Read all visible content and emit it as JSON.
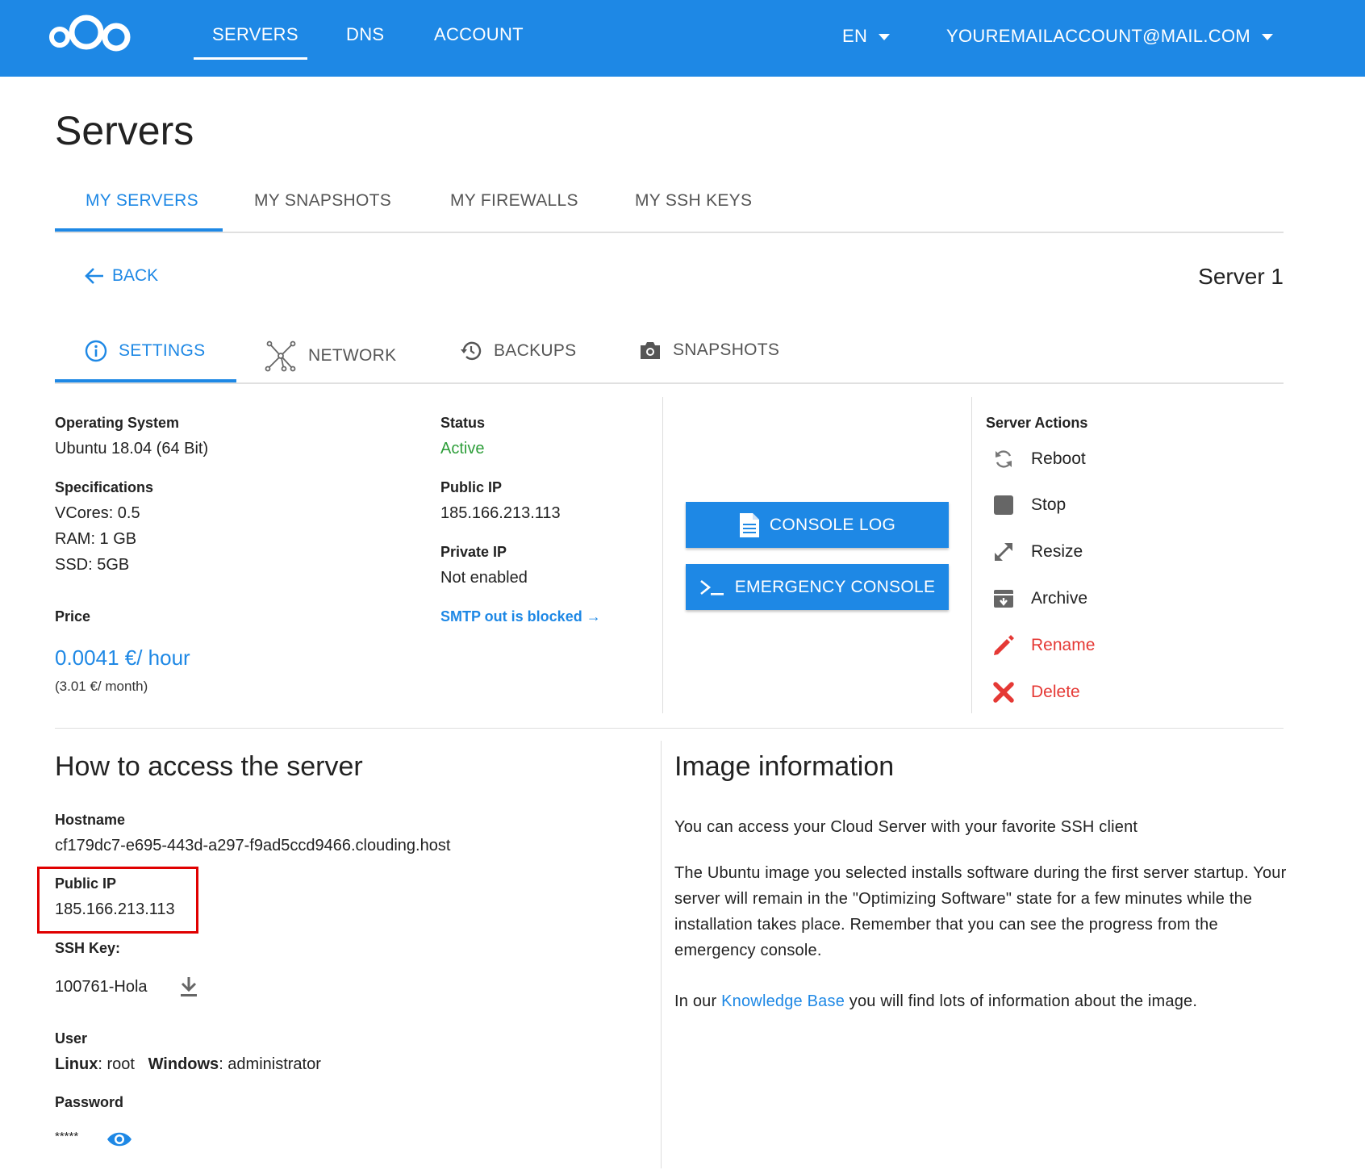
{
  "topbar": {
    "logo": "nextcloud-style-logo",
    "nav": [
      "SERVERS",
      "DNS",
      "ACCOUNT"
    ],
    "active_nav": "SERVERS",
    "language": "EN",
    "account": "YOUREMAILACCOUNT@MAIL.COM"
  },
  "page": {
    "title": "Servers"
  },
  "tabs": [
    "MY SERVERS",
    "MY SNAPSHOTS",
    "MY FIREWALLS",
    "MY SSH KEYS"
  ],
  "active_tab": "MY SERVERS",
  "back_label": "BACK",
  "server_name": "Server 1",
  "subtabs": [
    {
      "label": "SETTINGS",
      "icon": "info-icon"
    },
    {
      "label": "NETWORK",
      "icon": "network-icon"
    },
    {
      "label": "BACKUPS",
      "icon": "history-icon"
    },
    {
      "label": "SNAPSHOTS",
      "icon": "camera-icon"
    }
  ],
  "details": {
    "os_label": "Operating System",
    "os_value": "Ubuntu 18.04 (64 Bit)",
    "spec_label": "Specifications",
    "spec_vcores": "VCores: 0.5",
    "spec_ram": "RAM: 1 GB",
    "spec_ssd": "SSD: 5GB",
    "price_label": "Price",
    "price_hour": "0.0041 €/ hour",
    "price_month": "(3.01 €/ month)",
    "status_label": "Status",
    "status_value": "Active",
    "public_ip_label": "Public IP",
    "public_ip_value": "185.166.213.113",
    "private_ip_label": "Private IP",
    "private_ip_value": "Not enabled",
    "smtp_link": "SMTP out is blocked →"
  },
  "buttons": {
    "console_log": "CONSOLE LOG",
    "emergency_console": "EMERGENCY CONSOLE"
  },
  "actions": {
    "title": "Server Actions",
    "items": [
      {
        "label": "Reboot",
        "icon": "refresh-icon"
      },
      {
        "label": "Stop",
        "icon": "stop-icon"
      },
      {
        "label": "Resize",
        "icon": "resize-icon"
      },
      {
        "label": "Archive",
        "icon": "archive-icon"
      },
      {
        "label": "Rename",
        "icon": "pencil-icon"
      },
      {
        "label": "Delete",
        "icon": "close-icon"
      }
    ]
  },
  "access": {
    "title": "How to access the server",
    "hostname_label": "Hostname",
    "hostname_value": "cf179dc7-e695-443d-a297-f9ad5ccd9466.clouding.host",
    "public_ip_label": "Public IP",
    "public_ip_value": "185.166.213.113",
    "ssh_label": "SSH Key:",
    "ssh_value": "100761-Hola",
    "user_label": "User",
    "user_linux_key": "Linux",
    "user_linux_value": ": root",
    "user_windows_key": "Windows",
    "user_windows_value": ": administrator",
    "password_label": "Password",
    "password_value": "*****"
  },
  "image_info": {
    "title": "Image information",
    "p1": "You can access your Cloud Server with your favorite SSH client",
    "p2": "The Ubuntu image you selected installs software during the first server startup. Your server will remain in the \"Optimizing Software\" state for a few minutes while the installation takes place. Remember that you can see the progress from the emergency console.",
    "p3_before": "In our ",
    "p3_link": "Knowledge Base",
    "p3_after": " you will find lots of information about the image."
  },
  "colors": {
    "brand": "#1e88e5",
    "active": "#2e9e3a",
    "danger": "#e53935",
    "highlight": "#e00000"
  }
}
